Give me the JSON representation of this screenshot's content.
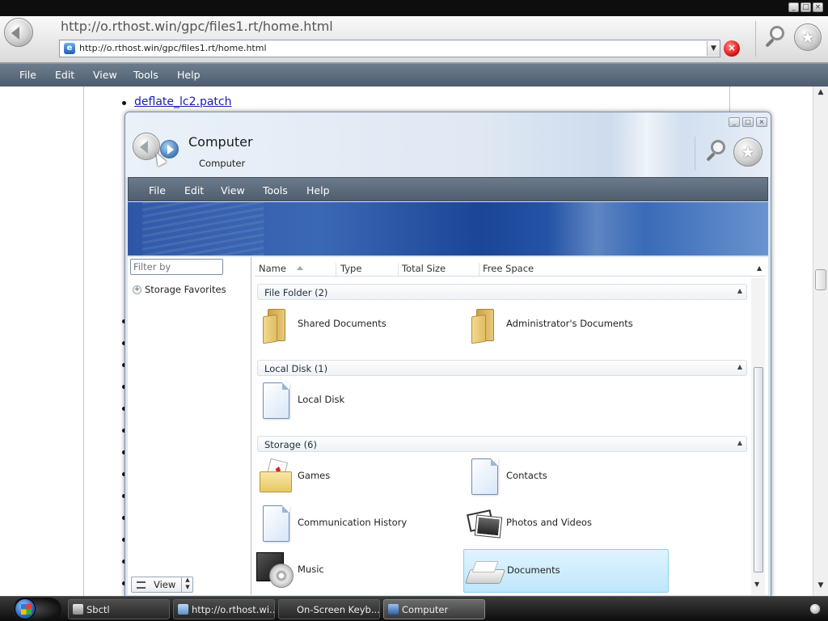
{
  "browser": {
    "page_title": "http://o.rthost.win/gpc/files1.rt/home.html",
    "address": "http://o.rthost.win/gpc/files1.rt/home.html",
    "menu": [
      "File",
      "Edit",
      "View",
      "Tools",
      "Help"
    ],
    "page_link": "deflate_lc2.patch"
  },
  "explorer": {
    "title": "Computer",
    "breadcrumb": "Computer",
    "menu": [
      "File",
      "Edit",
      "View",
      "Tools",
      "Help"
    ],
    "filter_placeholder": "Filter by",
    "storage_favorites": "Storage Favorites",
    "view_label": "View",
    "columns": [
      "Name",
      "Type",
      "Total Size",
      "Free Space"
    ],
    "groups": [
      {
        "label": "File Folder (2)",
        "items": [
          {
            "name": "Shared Documents",
            "icon": "folder-icon"
          },
          {
            "name": "Administrator's Documents",
            "icon": "folder-icon"
          }
        ]
      },
      {
        "label": "Local Disk (1)",
        "items": [
          {
            "name": "Local Disk",
            "icon": "document-icon"
          }
        ]
      },
      {
        "label": "Storage (6)",
        "items": [
          {
            "name": "Games",
            "icon": "games-icon"
          },
          {
            "name": "Contacts",
            "icon": "document-icon"
          },
          {
            "name": "Communication History",
            "icon": "document-icon"
          },
          {
            "name": "Photos and Videos",
            "icon": "photos-icon"
          },
          {
            "name": "Music",
            "icon": "music-icon"
          },
          {
            "name": "Documents",
            "icon": "documents-tray-icon",
            "selected": true
          }
        ]
      }
    ]
  },
  "taskbar": {
    "buttons": [
      {
        "label": "Sbctl"
      },
      {
        "label": "http://o.rthost.wi..."
      },
      {
        "label": "On-Screen Keyb..."
      },
      {
        "label": "Computer",
        "active": true
      }
    ]
  }
}
